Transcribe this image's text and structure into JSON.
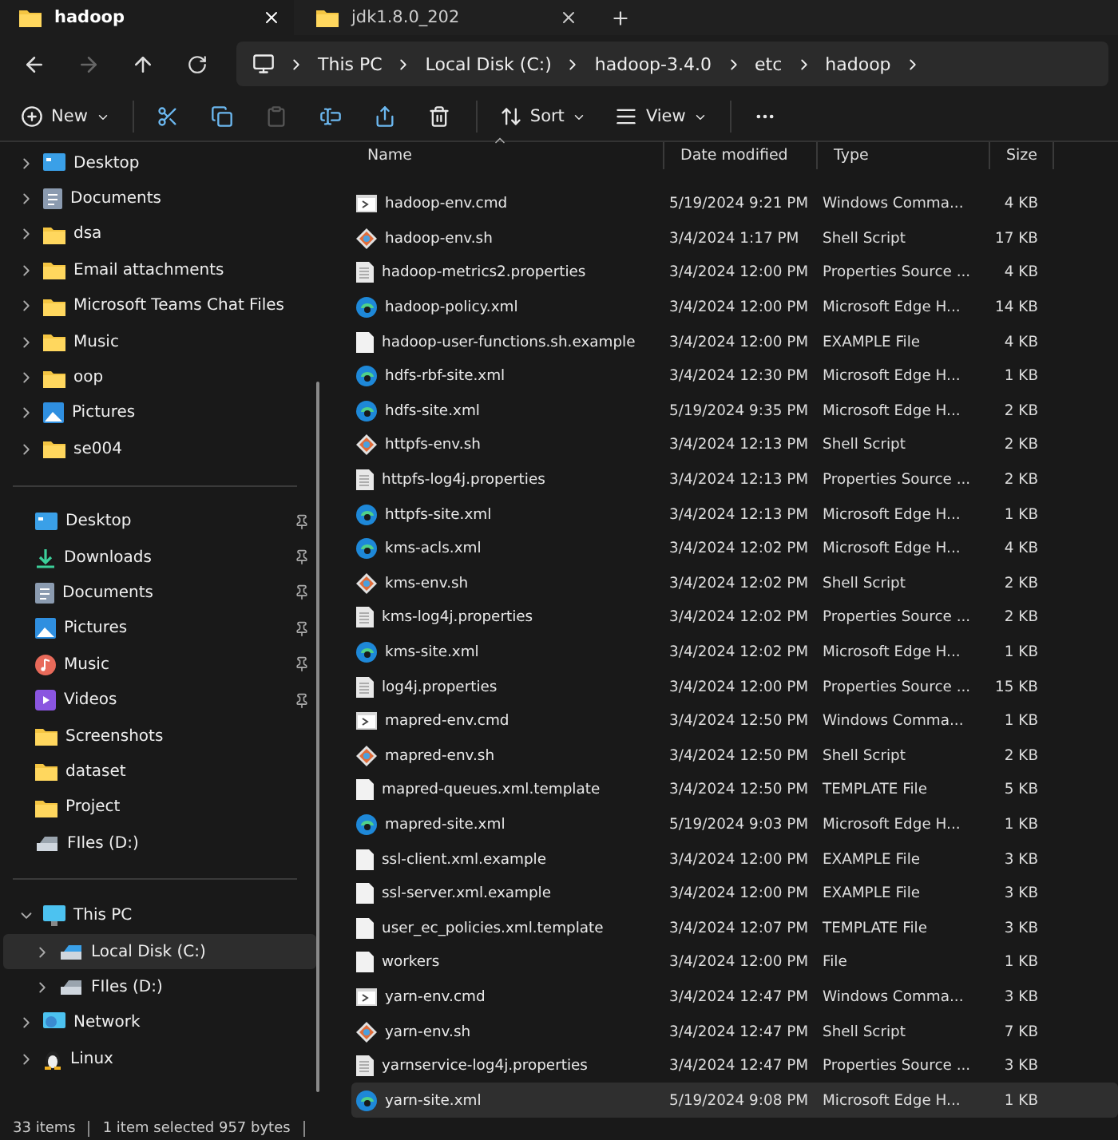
{
  "tabs": [
    {
      "title": "hadoop",
      "selected": true
    },
    {
      "title": "jdk1.8.0_202",
      "selected": false
    }
  ],
  "address": {
    "crumbs": [
      "This PC",
      "Local Disk (C:)",
      "hadoop-3.4.0",
      "etc",
      "hadoop"
    ]
  },
  "toolbar": {
    "actions": [
      {
        "kind": "new",
        "label": "New",
        "disabled": false
      },
      {
        "kind": "cut",
        "disabled": false
      },
      {
        "kind": "copy",
        "disabled": false
      },
      {
        "kind": "paste",
        "disabled": true
      },
      {
        "kind": "rename",
        "disabled": false
      },
      {
        "kind": "share",
        "disabled": false
      },
      {
        "kind": "delete",
        "disabled": false
      },
      {
        "kind": "sort",
        "label": "Sort",
        "disabled": false
      },
      {
        "kind": "view",
        "label": "View",
        "disabled": false
      },
      {
        "kind": "more",
        "disabled": false
      }
    ]
  },
  "sidebar": {
    "sections": [
      {
        "items": [
          {
            "label": "Desktop",
            "kind": "desktop",
            "expanded": false,
            "selected": false
          },
          {
            "label": "Documents",
            "kind": "documents",
            "expanded": false,
            "selected": false
          },
          {
            "label": "dsa",
            "kind": "folder",
            "expanded": false,
            "selected": false
          },
          {
            "label": "Email attachments",
            "kind": "folder",
            "expanded": false,
            "selected": false
          },
          {
            "label": "Microsoft Teams Chat Files",
            "kind": "folder",
            "expanded": false,
            "selected": false
          },
          {
            "label": "Music",
            "kind": "folder",
            "expanded": false,
            "selected": false
          },
          {
            "label": "oop",
            "kind": "folder",
            "expanded": false,
            "selected": false
          },
          {
            "label": "Pictures",
            "kind": "pictures",
            "expanded": false,
            "selected": false
          },
          {
            "label": "se004",
            "kind": "folder",
            "expanded": false,
            "selected": false
          }
        ]
      },
      {
        "items": [
          {
            "label": "Desktop",
            "kind": "desktop",
            "pinned": true,
            "selected": false
          },
          {
            "label": "Downloads",
            "kind": "downloads",
            "pinned": true,
            "selected": false
          },
          {
            "label": "Documents",
            "kind": "documents",
            "pinned": true,
            "selected": false
          },
          {
            "label": "Pictures",
            "kind": "pictures",
            "pinned": true,
            "selected": false
          },
          {
            "label": "Music",
            "kind": "music",
            "pinned": true,
            "selected": false
          },
          {
            "label": "Videos",
            "kind": "videos",
            "pinned": true,
            "selected": false
          },
          {
            "label": "Screenshots",
            "kind": "folder",
            "pinned": false,
            "selected": false
          },
          {
            "label": "dataset",
            "kind": "folder",
            "pinned": false,
            "selected": false
          },
          {
            "label": "Project",
            "kind": "folder",
            "pinned": false,
            "selected": false
          },
          {
            "label": "FIles (D:)",
            "kind": "drive",
            "pinned": false,
            "selected": false
          }
        ]
      },
      {
        "items": [
          {
            "label": "This PC",
            "kind": "pc",
            "expanded": true,
            "selected": false,
            "children": [
              {
                "label": "Local Disk (C:)",
                "kind": "system-drive",
                "expanded": false,
                "selected": true
              },
              {
                "label": "FIles (D:)",
                "kind": "drive",
                "expanded": false,
                "selected": false
              }
            ]
          },
          {
            "label": "Network",
            "kind": "network",
            "expanded": false,
            "selected": false
          },
          {
            "label": "Linux",
            "kind": "linux",
            "expanded": false,
            "selected": false
          }
        ]
      }
    ]
  },
  "columns": [
    "Name",
    "Date modified",
    "Type",
    "Size"
  ],
  "files": [
    {
      "name": "hadoop-env.cmd",
      "kind": "cmd",
      "date": "5/19/2024 9:21 PM",
      "type": "Windows Comma...",
      "size": "4 KB",
      "selected": false
    },
    {
      "name": "hadoop-env.sh",
      "kind": "shell",
      "date": "3/4/2024 1:17 PM",
      "type": "Shell Script",
      "size": "17 KB",
      "selected": false
    },
    {
      "name": "hadoop-metrics2.properties",
      "kind": "text",
      "date": "3/4/2024 12:00 PM",
      "type": "Properties Source ...",
      "size": "4 KB",
      "selected": false
    },
    {
      "name": "hadoop-policy.xml",
      "kind": "edge",
      "date": "3/4/2024 12:00 PM",
      "type": "Microsoft Edge H...",
      "size": "14 KB",
      "selected": false
    },
    {
      "name": "hadoop-user-functions.sh.example",
      "kind": "blank",
      "date": "3/4/2024 12:00 PM",
      "type": "EXAMPLE File",
      "size": "4 KB",
      "selected": false
    },
    {
      "name": "hdfs-rbf-site.xml",
      "kind": "edge",
      "date": "3/4/2024 12:30 PM",
      "type": "Microsoft Edge H...",
      "size": "1 KB",
      "selected": false
    },
    {
      "name": "hdfs-site.xml",
      "kind": "edge",
      "date": "5/19/2024 9:35 PM",
      "type": "Microsoft Edge H...",
      "size": "2 KB",
      "selected": false
    },
    {
      "name": "httpfs-env.sh",
      "kind": "shell",
      "date": "3/4/2024 12:13 PM",
      "type": "Shell Script",
      "size": "2 KB",
      "selected": false
    },
    {
      "name": "httpfs-log4j.properties",
      "kind": "text",
      "date": "3/4/2024 12:13 PM",
      "type": "Properties Source ...",
      "size": "2 KB",
      "selected": false
    },
    {
      "name": "httpfs-site.xml",
      "kind": "edge",
      "date": "3/4/2024 12:13 PM",
      "type": "Microsoft Edge H...",
      "size": "1 KB",
      "selected": false
    },
    {
      "name": "kms-acls.xml",
      "kind": "edge",
      "date": "3/4/2024 12:02 PM",
      "type": "Microsoft Edge H...",
      "size": "4 KB",
      "selected": false
    },
    {
      "name": "kms-env.sh",
      "kind": "shell",
      "date": "3/4/2024 12:02 PM",
      "type": "Shell Script",
      "size": "2 KB",
      "selected": false
    },
    {
      "name": "kms-log4j.properties",
      "kind": "text",
      "date": "3/4/2024 12:02 PM",
      "type": "Properties Source ...",
      "size": "2 KB",
      "selected": false
    },
    {
      "name": "kms-site.xml",
      "kind": "edge",
      "date": "3/4/2024 12:02 PM",
      "type": "Microsoft Edge H...",
      "size": "1 KB",
      "selected": false
    },
    {
      "name": "log4j.properties",
      "kind": "text",
      "date": "3/4/2024 12:00 PM",
      "type": "Properties Source ...",
      "size": "15 KB",
      "selected": false
    },
    {
      "name": "mapred-env.cmd",
      "kind": "cmd",
      "date": "3/4/2024 12:50 PM",
      "type": "Windows Comma...",
      "size": "1 KB",
      "selected": false
    },
    {
      "name": "mapred-env.sh",
      "kind": "shell",
      "date": "3/4/2024 12:50 PM",
      "type": "Shell Script",
      "size": "2 KB",
      "selected": false
    },
    {
      "name": "mapred-queues.xml.template",
      "kind": "blank",
      "date": "3/4/2024 12:50 PM",
      "type": "TEMPLATE File",
      "size": "5 KB",
      "selected": false
    },
    {
      "name": "mapred-site.xml",
      "kind": "edge",
      "date": "5/19/2024 9:03 PM",
      "type": "Microsoft Edge H...",
      "size": "1 KB",
      "selected": false
    },
    {
      "name": "ssl-client.xml.example",
      "kind": "blank",
      "date": "3/4/2024 12:00 PM",
      "type": "EXAMPLE File",
      "size": "3 KB",
      "selected": false
    },
    {
      "name": "ssl-server.xml.example",
      "kind": "blank",
      "date": "3/4/2024 12:00 PM",
      "type": "EXAMPLE File",
      "size": "3 KB",
      "selected": false
    },
    {
      "name": "user_ec_policies.xml.template",
      "kind": "blank",
      "date": "3/4/2024 12:07 PM",
      "type": "TEMPLATE File",
      "size": "3 KB",
      "selected": false
    },
    {
      "name": "workers",
      "kind": "blank",
      "date": "3/4/2024 12:00 PM",
      "type": "File",
      "size": "1 KB",
      "selected": false
    },
    {
      "name": "yarn-env.cmd",
      "kind": "cmd",
      "date": "3/4/2024 12:47 PM",
      "type": "Windows Comma...",
      "size": "3 KB",
      "selected": false
    },
    {
      "name": "yarn-env.sh",
      "kind": "shell",
      "date": "3/4/2024 12:47 PM",
      "type": "Shell Script",
      "size": "7 KB",
      "selected": false
    },
    {
      "name": "yarnservice-log4j.properties",
      "kind": "text",
      "date": "3/4/2024 12:47 PM",
      "type": "Properties Source ...",
      "size": "3 KB",
      "selected": false
    },
    {
      "name": "yarn-site.xml",
      "kind": "edge",
      "date": "5/19/2024 9:08 PM",
      "type": "Microsoft Edge H...",
      "size": "1 KB",
      "selected": true
    }
  ],
  "status_bar": {
    "count": "33 items",
    "selection": "1 item selected  957 bytes"
  }
}
